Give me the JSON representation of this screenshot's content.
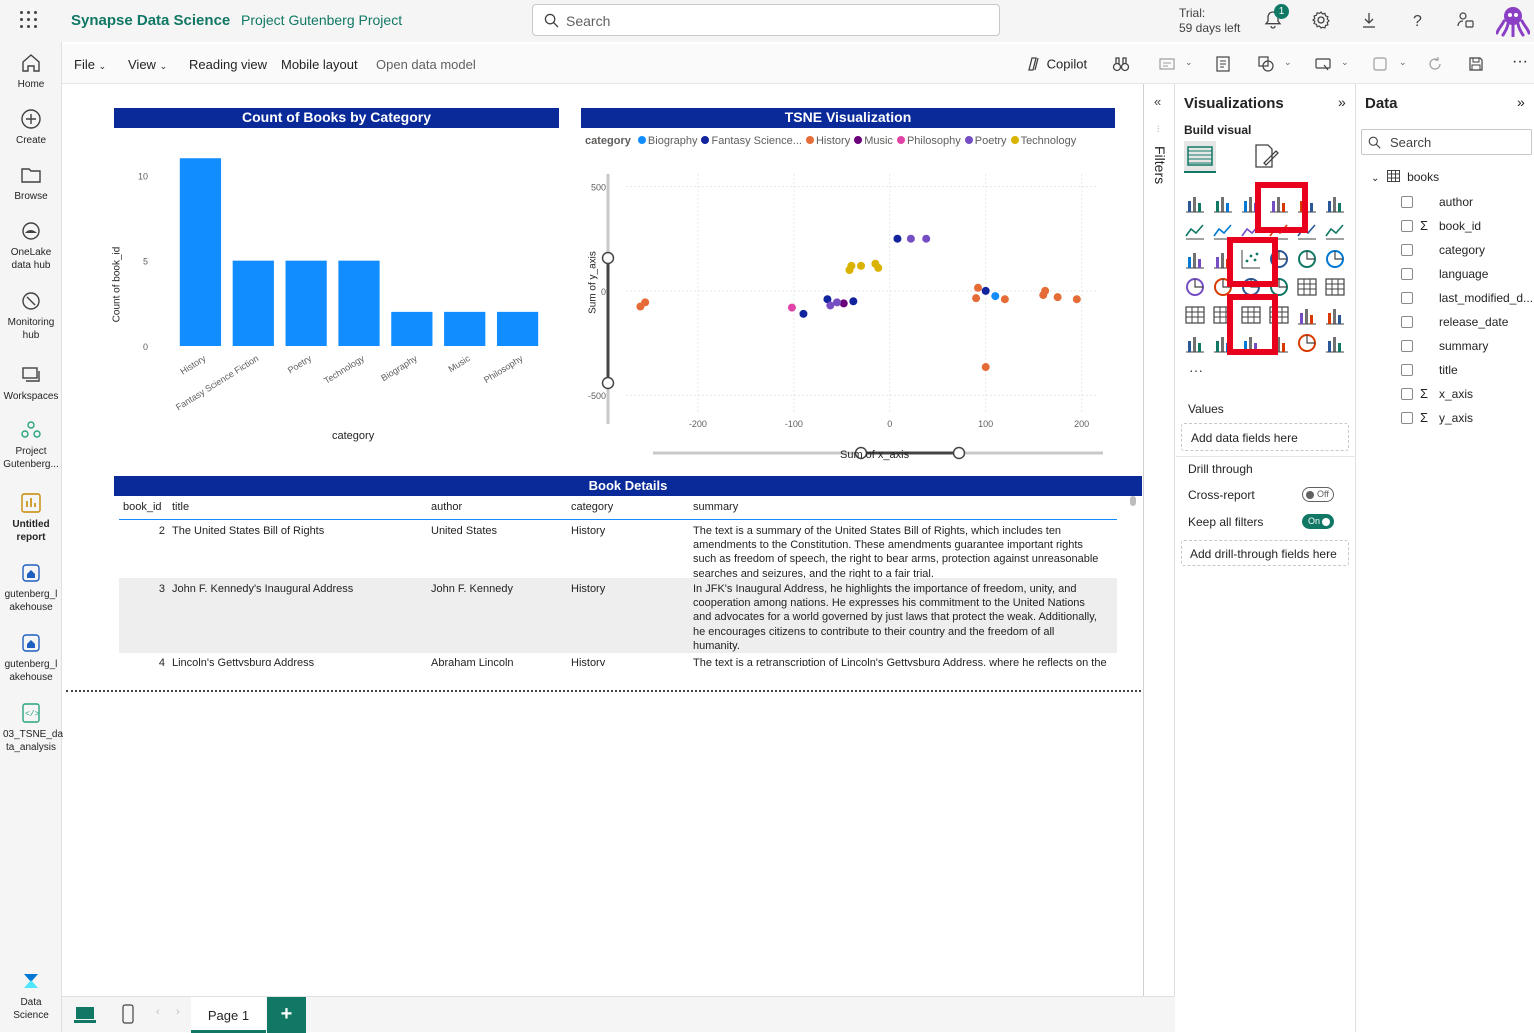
{
  "app": {
    "brand": "Synapse Data Science",
    "project": "Project Gutenberg Project",
    "search_placeholder": "Search",
    "trial_line1": "Trial:",
    "trial_line2": "59 days left",
    "notification_count": "1"
  },
  "leftnav": [
    {
      "id": "home",
      "label": "Home"
    },
    {
      "id": "create",
      "label": "Create"
    },
    {
      "id": "browse",
      "label": "Browse"
    },
    {
      "id": "onelake",
      "label": "OneLake data hub"
    },
    {
      "id": "monitoring",
      "label": "Monitoring hub"
    },
    {
      "id": "workspaces",
      "label": "Workspaces"
    },
    {
      "id": "project",
      "label": "Project Gutenberg..."
    },
    {
      "id": "report",
      "label": "Untitled report"
    },
    {
      "id": "lakehouse1",
      "label": "gutenberg_l akehouse"
    },
    {
      "id": "lakehouse2",
      "label": "gutenberg_l akehouse"
    },
    {
      "id": "notebook",
      "label": "03_TSNE_da ta_analysis"
    },
    {
      "id": "datascience",
      "label": "Data Science"
    }
  ],
  "ribbon": {
    "file": "File",
    "view": "View",
    "reading": "Reading view",
    "mobile": "Mobile layout",
    "open_model": "Open data model",
    "copilot": "Copilot"
  },
  "bar_chart": {
    "title": "Count of Books by Category",
    "xlabel": "category",
    "ylabel": "Count of book_id"
  },
  "tsne": {
    "title": "TSNE Visualization",
    "legend_title": "category",
    "xlabel": "Sum of x_axis",
    "ylabel": "Sum of y_axis"
  },
  "chart_data": [
    {
      "type": "bar",
      "title": "Count of Books by Category",
      "xlabel": "category",
      "ylabel": "Count of book_id",
      "categories": [
        "History",
        "Fantasy Science Fiction",
        "Poetry",
        "Technology",
        "Biography",
        "Music",
        "Philosophy"
      ],
      "values": [
        11,
        5,
        5,
        5,
        2,
        2,
        2
      ],
      "ylim": [
        0,
        11.6
      ],
      "yticks": [
        0,
        5,
        10
      ],
      "color": "#118dff"
    },
    {
      "type": "scatter",
      "title": "TSNE Visualization",
      "xlabel": "Sum of x_axis",
      "ylabel": "Sum of y_axis",
      "xlim": [
        -275,
        215
      ],
      "ylim": [
        -590,
        560
      ],
      "xticks": [
        -200,
        -100,
        0,
        100,
        200
      ],
      "yticks": [
        500,
        0,
        -500
      ],
      "series": [
        {
          "name": "Biography",
          "color": "#118dff",
          "points": [
            [
              110,
              -25
            ]
          ]
        },
        {
          "name": "Fantasy Science Fiction",
          "color": "#12239e",
          "points": [
            [
              -90,
              -110
            ],
            [
              -65,
              -40
            ],
            [
              -38,
              -50
            ],
            [
              8,
              250
            ],
            [
              100,
              0
            ]
          ]
        },
        {
          "name": "History",
          "color": "#e66c37",
          "points": [
            [
              -260,
              -75
            ],
            [
              -255,
              -55
            ],
            [
              92,
              15
            ],
            [
              90,
              -35
            ],
            [
              120,
              -40
            ],
            [
              160,
              -20
            ],
            [
              162,
              0
            ],
            [
              175,
              -30
            ],
            [
              195,
              -40
            ],
            [
              100,
              -365
            ]
          ]
        },
        {
          "name": "Music",
          "color": "#6b007b",
          "points": [
            [
              -48,
              -60
            ]
          ]
        },
        {
          "name": "Philosophy",
          "color": "#e044a7",
          "points": [
            [
              -102,
              -80
            ]
          ]
        },
        {
          "name": "Poetry",
          "color": "#744ec2",
          "points": [
            [
              -55,
              -55
            ],
            [
              -62,
              -70
            ],
            [
              22,
              250
            ],
            [
              38,
              250
            ]
          ]
        },
        {
          "name": "Technology",
          "color": "#d9b300",
          "points": [
            [
              -40,
              120
            ],
            [
              -42,
              100
            ],
            [
              -30,
              120
            ],
            [
              -15,
              130
            ],
            [
              -12,
              110
            ]
          ]
        }
      ]
    }
  ],
  "table": {
    "title": "Book Details",
    "columns": [
      "book_id",
      "title",
      "author",
      "category",
      "summary"
    ],
    "rows": [
      {
        "book_id": "2",
        "title": "The United States Bill of Rights",
        "author": "United States",
        "category": "History",
        "summary": [
          "The text is a summary of the United States Bill of Rights, which includes ten",
          "amendments to the Constitution. These amendments guarantee important rights",
          "such as freedom of speech, the right to bear arms, protection against unreasonable",
          "searches and seizures, and the right to a fair trial."
        ]
      },
      {
        "book_id": "3",
        "title": "John F. Kennedy's Inaugural Address",
        "author": "John F. Kennedy",
        "category": "History",
        "summary": [
          "In JFK's Inaugural Address, he highlights the importance of freedom, unity, and",
          "cooperation among nations. He expresses his commitment to the United Nations",
          "and advocates for a world governed by just laws that protect the weak. Additionally,",
          "he encourages citizens to contribute to their country and the freedom of all",
          "humanity."
        ]
      },
      {
        "book_id": "4",
        "title": "Lincoln's Gettysburg Address",
        "author": "Abraham Lincoln",
        "category": "History",
        "summary": [
          "The text is a retranscription of Lincoln's Gettysburg Address, where he reflects on the"
        ]
      }
    ]
  },
  "filters_label": "Filters",
  "viz_pane": {
    "title": "Visualizations",
    "build_visual": "Build visual",
    "values": "Values",
    "add_fields": "Add data fields here",
    "drill_through": "Drill through",
    "cross_report": "Cross-report",
    "cross_report_state": "Off",
    "keep_filters": "Keep all filters",
    "keep_filters_state": "On",
    "add_drill": "Add drill-through fields here"
  },
  "data_pane": {
    "title": "Data",
    "search_placeholder": "Search",
    "table_name": "books",
    "fields": [
      {
        "name": "author",
        "sigma": ""
      },
      {
        "name": "book_id",
        "sigma": "Σ"
      },
      {
        "name": "category",
        "sigma": ""
      },
      {
        "name": "language",
        "sigma": ""
      },
      {
        "name": "last_modified_d...",
        "sigma": ""
      },
      {
        "name": "release_date",
        "sigma": ""
      },
      {
        "name": "summary",
        "sigma": ""
      },
      {
        "name": "title",
        "sigma": ""
      },
      {
        "name": "x_axis",
        "sigma": "Σ"
      },
      {
        "name": "y_axis",
        "sigma": "Σ"
      }
    ]
  },
  "bottom": {
    "page_tab": "Page 1",
    "add_label": "+"
  }
}
